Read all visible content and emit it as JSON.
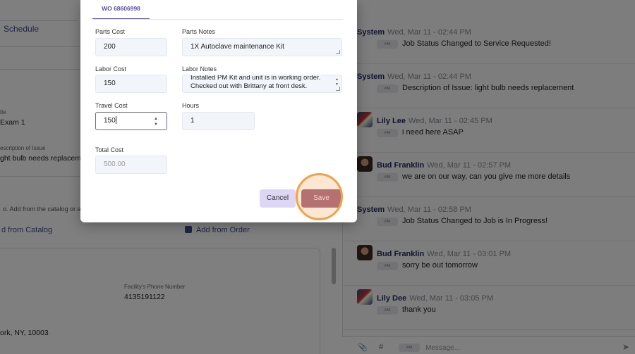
{
  "background": {
    "schedule_tab": "Schedule",
    "title_label": "tle",
    "title_value": "Exam 1",
    "issue_label": "escription of Issue",
    "issue_value": "ght bulb needs replacement",
    "catalog_hint": "o. Add from the catalog or af",
    "add_from_catalog": "d from Catalog",
    "add_from_order": "Add from Order",
    "facility_phone_label": "Facility's Phone Number",
    "facility_phone": "4135191122",
    "address": "ork, NY, 10003"
  },
  "chat": {
    "messages": [
      {
        "author": "System",
        "time": "Wed, Mar 11 - 02:44 PM",
        "chip": "#All",
        "text": "Job Status Changed to Service Requested!",
        "avatar": "none"
      },
      {
        "author": "System",
        "time": "Wed, Mar 11 - 02:44 PM",
        "chip": "#All",
        "text": "Description of Issue: light bulb needs replacement",
        "avatar": "none"
      },
      {
        "author": "Lily Lee",
        "time": "Wed, Mar 11 - 02:45 PM",
        "chip": "#All",
        "text": "i need here ASAP",
        "avatar": "lily"
      },
      {
        "author": "Bud Franklin",
        "time": "Wed, Mar 11 - 02:57 PM",
        "chip": "#All",
        "text": "we are on our way, can you give me more details",
        "avatar": "bud"
      },
      {
        "author": "System",
        "time": "Wed, Mar 11 - 02:58 PM",
        "chip": "#All",
        "text": "Job Status Changed to Job is In Progress!",
        "avatar": "none"
      },
      {
        "author": "Bud Franklin",
        "time": "Wed, Mar 11 - 03:01 PM",
        "chip": "#All",
        "text": "sorry be out tomorrow",
        "avatar": "bud"
      },
      {
        "author": "Lily Dee",
        "time": "Wed, Mar 11 - 03:05 PM",
        "chip": "#All",
        "text": "thank you",
        "avatar": "lily"
      }
    ],
    "compose": {
      "attach_icon": "paperclip-icon",
      "hash_icon": "hash-icon",
      "chip": "#All",
      "placeholder": "Message...",
      "send_icon": "send-icon"
    }
  },
  "modal": {
    "tab": "WO 68606998",
    "parts_cost_label": "Parts Cost",
    "parts_cost": "200",
    "parts_notes_label": "Parts Notes",
    "parts_notes": "1X Autoclave maintenance Kit",
    "labor_cost_label": "Labor Cost",
    "labor_cost": "150",
    "labor_notes_label": "Labor Notes",
    "labor_notes_line1": "Installed PM Kit and unit is in working order.",
    "labor_notes_line2": "Checked out with Brittany at front desk.",
    "travel_cost_label": "Travel Cost",
    "travel_cost": "150",
    "hours_label": "Hours",
    "hours": "1",
    "total_cost_label": "Total Cost",
    "total_cost": "500.00",
    "cancel_label": "Cancel",
    "save_label": "Save",
    "accent_color": "#5b4f9e",
    "save_color": "#a1627f",
    "highlight_color": "#f3a14a"
  }
}
